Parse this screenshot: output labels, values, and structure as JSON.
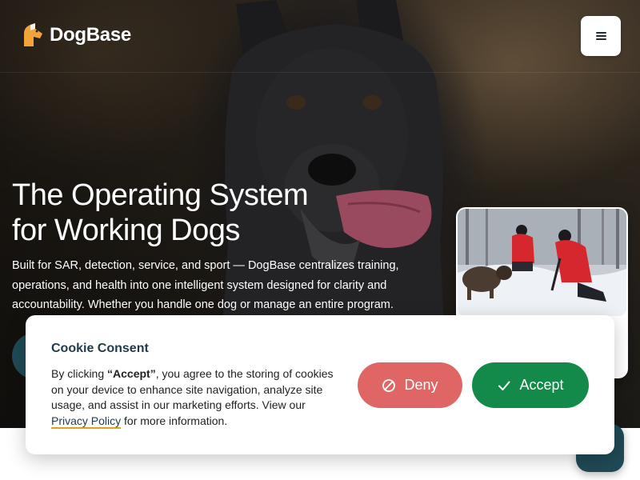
{
  "brand": {
    "name": "DogBase"
  },
  "hero": {
    "headline": "The Operating System for Working Dogs",
    "subtext": "Built for SAR, detection, service, and sport — DogBase centralizes training, operations, and health into one intelligent system designed for clarity and accountability. Whether you handle one dog or manage an entire program."
  },
  "consent": {
    "title": "Cookie Consent",
    "body_prefix": "By clicking ",
    "body_bold": "“Accept”",
    "body_middle": ", you agree to the storing of cookies on your device to enhance site navigation, analyze site usage, and assist in our marketing efforts. View our ",
    "privacy_link": "Privacy Policy",
    "body_suffix": " for more information.",
    "deny_label": "Deny",
    "accept_label": "Accept"
  },
  "icons": {
    "logo": "dog-head-icon",
    "menu": "hamburger-menu-icon",
    "deny": "ban-icon",
    "accept": "check-icon",
    "chat": "send-icon"
  },
  "colors": {
    "primary_dark": "#1f4a56",
    "deny": "#e06666",
    "accept": "#148a4a",
    "title": "#1f3a4a",
    "link_underline": "#e0a11b",
    "logo_orange": "#f2a33a"
  }
}
